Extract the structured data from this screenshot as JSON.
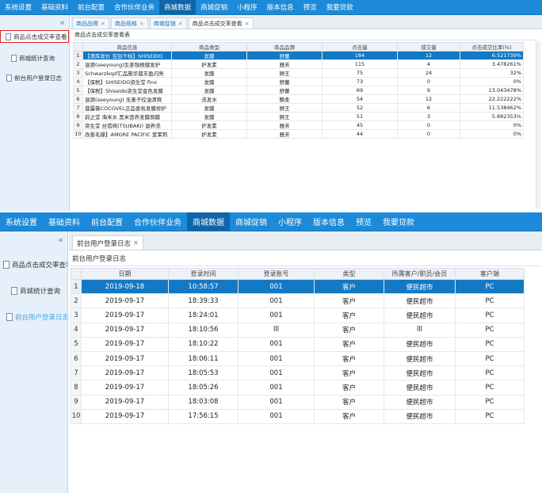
{
  "nav": [
    "系统设置",
    "基础资料",
    "前台配置",
    "合作伙伴业务",
    "商城数据",
    "商城促销",
    "小程序",
    "版本信息",
    "预览",
    "我要贷款"
  ],
  "nav_active_index": 4,
  "collapse_glyph": "«",
  "tab_close": "×",
  "shot1": {
    "sidebar": [
      "商品点击成交率查看",
      "商城统计查询",
      "前台用户登录日志"
    ],
    "tabs": [
      "商品品牌",
      "商品规格",
      "商城促销",
      "商品点击成交率查看"
    ],
    "panel_title": "商品点击成交率查看表",
    "columns": [
      "",
      "商品信息",
      "商品类型",
      "商品品牌",
      "点击量",
      "成交量",
      "点击成交比率(%)"
    ],
    "rows": [
      [
        "1",
        "【清库发价 告别干枯】SHISEIDO",
        "发膜",
        "舒蕾",
        "184",
        "12",
        "6.521739%"
      ],
      [
        "2",
        "滋源(seeyoung)生姜强根健发护",
        "护发素",
        "雅芳",
        "115",
        "4",
        "3.478261%"
      ],
      [
        "3",
        "Schwarzkopf汇品施华蔻丰盈闪亮",
        "发膜",
        "狮王",
        "75",
        "24",
        "32%"
      ],
      [
        "4",
        "【保税】SHISEIDO资生堂 fino",
        "发膜",
        "舒蕾",
        "73",
        "0",
        "0%"
      ],
      [
        "5",
        "【保税】Shiseido资生堂金色发膜",
        "发膜",
        "舒蕾",
        "69",
        "9",
        "13.043478%"
      ],
      [
        "6",
        "滋源(seeyoung) 无患子控油清爽",
        "洗发水",
        "飘柔",
        "54",
        "12",
        "22.222222%"
      ],
      [
        "7",
        "蔻露薇COCOVEL正品香氛发膜修护",
        "发膜",
        "狮王",
        "52",
        "6",
        "11.538462%"
      ],
      [
        "8",
        "韵之堂 海米水 黑米营养发膜倒膜",
        "发膜",
        "狮王",
        "51",
        "3",
        "5.882353%"
      ],
      [
        "9",
        "资生堂 丝蓓绮(TSUBAKI) 滋养洗",
        "护发素",
        "雅芳",
        "45",
        "0",
        "0%"
      ],
      [
        "10",
        "改善毛躁】AMORE PACIFIC 爱茉莉",
        "护发素",
        "雅芳",
        "44",
        "0",
        "0%"
      ]
    ]
  },
  "shot2": {
    "sidebar": [
      "商品点击成交率查看",
      "商城统计查询",
      "前台用户登录日志"
    ],
    "tabs": [
      "前台用户登录日志"
    ],
    "panel_title": "前台用户登录日志",
    "columns": [
      "",
      "日期",
      "登录时间",
      "登录账号",
      "类型",
      "所属客户/职员/会员",
      "客户端"
    ],
    "rows": [
      [
        "1",
        "2019-09-18",
        "10:58:57",
        "001",
        "客户",
        "便民超市",
        "PC"
      ],
      [
        "2",
        "2019-09-17",
        "18:39:33",
        "001",
        "客户",
        "便民超市",
        "PC"
      ],
      [
        "3",
        "2019-09-17",
        "18:24:01",
        "001",
        "客户",
        "便民超市",
        "PC"
      ],
      [
        "4",
        "2019-09-17",
        "18:10:56",
        "lll",
        "客户",
        "lll",
        "PC"
      ],
      [
        "5",
        "2019-09-17",
        "18:10:22",
        "001",
        "客户",
        "便民超市",
        "PC"
      ],
      [
        "6",
        "2019-09-17",
        "18:06:11",
        "001",
        "客户",
        "便民超市",
        "PC"
      ],
      [
        "7",
        "2019-09-17",
        "18:05:53",
        "001",
        "客户",
        "便民超市",
        "PC"
      ],
      [
        "8",
        "2019-09-17",
        "18:05:26",
        "001",
        "客户",
        "便民超市",
        "PC"
      ],
      [
        "9",
        "2019-09-17",
        "18:03:08",
        "001",
        "客户",
        "便民超市",
        "PC"
      ],
      [
        "10",
        "2019-09-17",
        "17:56:15",
        "001",
        "客户",
        "便民超市",
        "PC"
      ]
    ]
  }
}
